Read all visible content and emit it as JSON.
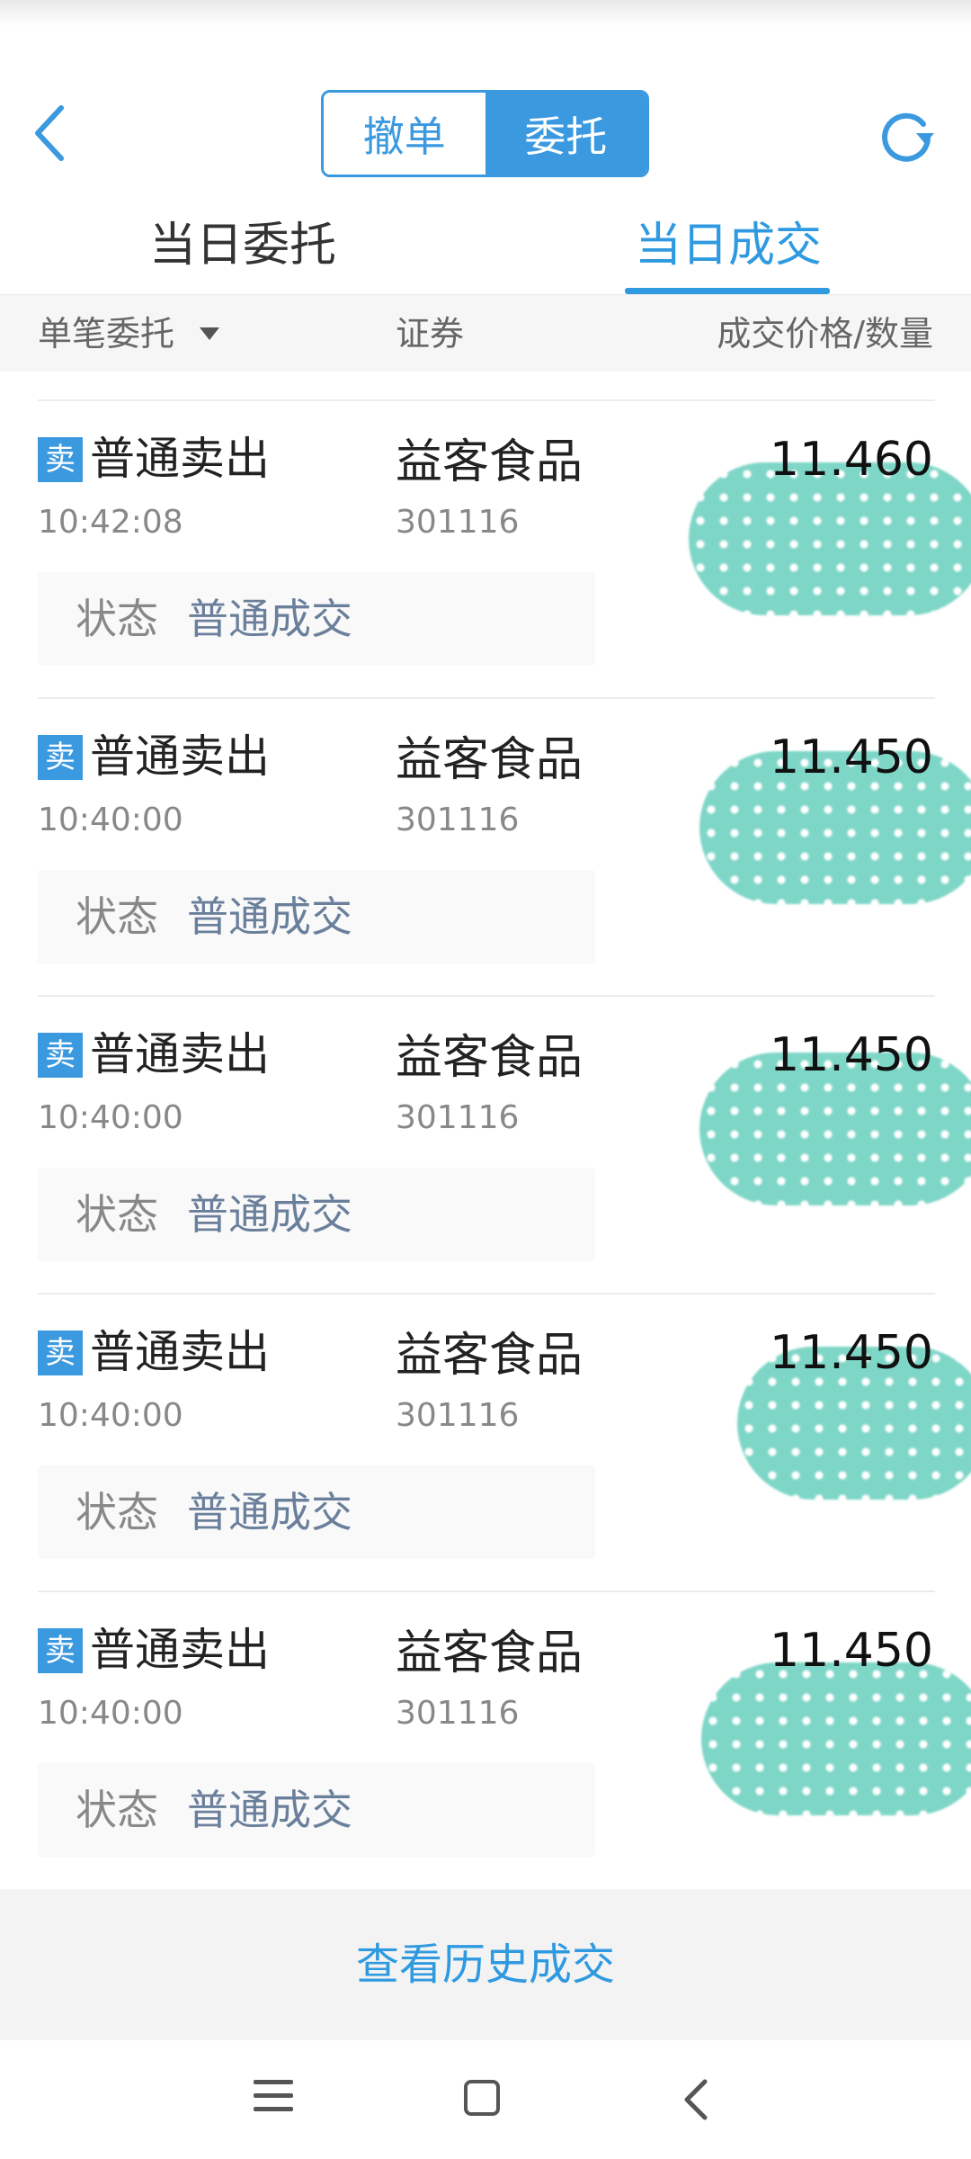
{
  "header": {
    "segmented": {
      "cancel_label": "撤单",
      "entrust_label": "委托",
      "active": "委托"
    },
    "back_icon": "chevron-left-icon",
    "refresh_icon": "refresh-icon"
  },
  "tabs": [
    {
      "label": "当日委托",
      "active": false
    },
    {
      "label": "当日成交",
      "active": true
    }
  ],
  "columns": {
    "filter_label": "单笔委托",
    "security_label": "证券",
    "price_qty_label": "成交价格/数量"
  },
  "records": [
    {
      "badge": "卖",
      "type": "普通卖出",
      "time": "10:42:08",
      "name": "益客食品",
      "code": "301116",
      "price": "11.460",
      "status_label": "状态",
      "status": "普通成交"
    },
    {
      "badge": "卖",
      "type": "普通卖出",
      "time": "10:40:00",
      "name": "益客食品",
      "code": "301116",
      "price": "11.450",
      "status_label": "状态",
      "status": "普通成交"
    },
    {
      "badge": "卖",
      "type": "普通卖出",
      "time": "10:40:00",
      "name": "益客食品",
      "code": "301116",
      "price": "11.450",
      "status_label": "状态",
      "status": "普通成交"
    },
    {
      "badge": "卖",
      "type": "普通卖出",
      "time": "10:40:00",
      "name": "益客食品",
      "code": "301116",
      "price": "11.450",
      "status_label": "状态",
      "status": "普通成交"
    },
    {
      "badge": "卖",
      "type": "普通卖出",
      "time": "10:40:00",
      "name": "益客食品",
      "code": "301116",
      "price": "11.450",
      "status_label": "状态",
      "status": "普通成交"
    }
  ],
  "footer": {
    "history_link": "查看历史成交"
  },
  "colors": {
    "accent": "#3b99e0",
    "redaction": "#7ed6c7"
  }
}
